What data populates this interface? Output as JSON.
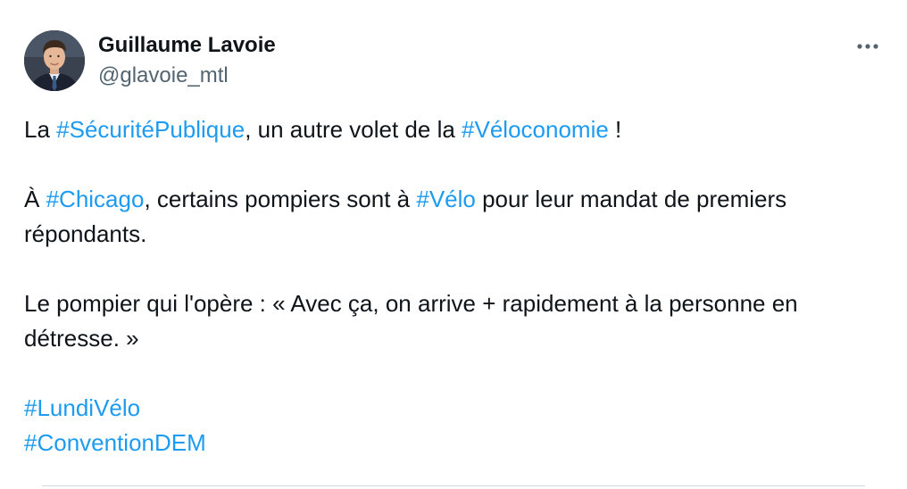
{
  "author": {
    "name": "Guillaume Lavoie",
    "handle": "@glavoie_mtl"
  },
  "more_icon": "more-horizontal-icon",
  "tweet": {
    "p1": {
      "t1": "La ",
      "h1": "#SécuritéPublique",
      "t2": ", un autre volet de la ",
      "h2": "#Véloconomie",
      "t3": " !"
    },
    "p2": {
      "t1": "À ",
      "h1": "#Chicago",
      "t2": ", certains pompiers sont à ",
      "h2": "#Vélo",
      "t3": " pour leur mandat de premiers répondants."
    },
    "p3": {
      "t1": "Le pompier qui l'opère : « Avec ça, on arrive + rapidement à la personne en détresse. »"
    },
    "hashtags": [
      "#LundiVélo",
      "#ConventionDEM"
    ]
  },
  "colors": {
    "hashtag": "#1d9bf0",
    "text": "#0f1419",
    "secondary": "#536471"
  }
}
